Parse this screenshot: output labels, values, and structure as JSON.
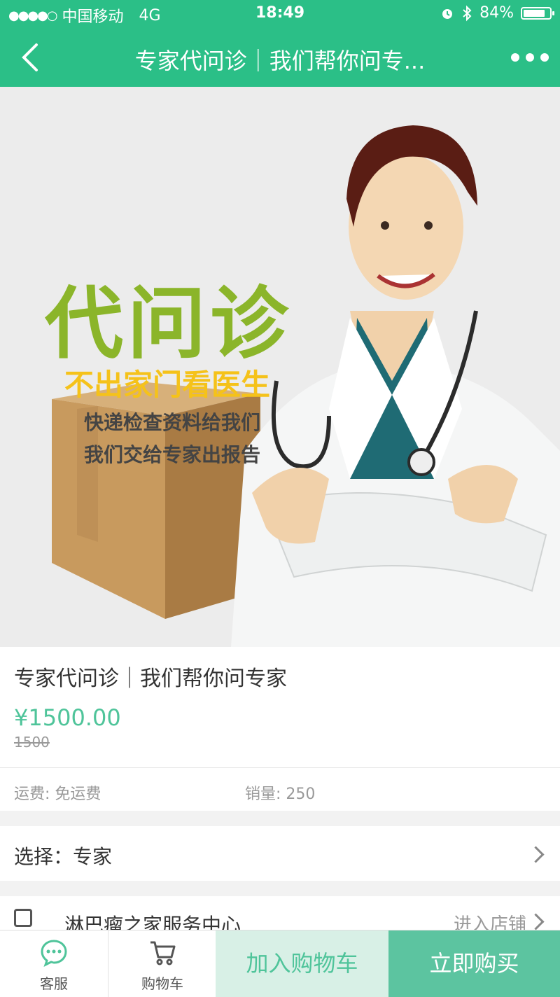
{
  "status_bar": {
    "signal": "●●●●○",
    "carrier": "中国移动",
    "network": "4G",
    "time": "18:49",
    "battery_percent": "84%",
    "battery_level": 0.84,
    "icons": [
      "alarm-icon",
      "bluetooth-icon",
      "battery-icon"
    ]
  },
  "navbar": {
    "title": "专家代问诊｜我们帮你问专...",
    "back_icon": "chevron-left-icon",
    "more_icon": "more-dots-icon"
  },
  "banner": {
    "headline": "代问诊",
    "subheadline": "不出家门看医生",
    "line1": "快递检查资料给我们",
    "line2": "我们交给专家出报告"
  },
  "product": {
    "title": "专家代问诊｜我们帮你问专家",
    "price": "¥1500.00",
    "original_price": "1500",
    "shipping": "运费: 免运费",
    "sales": "销量: 250"
  },
  "options": {
    "select_label": "选择：专家"
  },
  "store": {
    "name": "淋巴瘤之家服务中心",
    "enter_label": "进入店铺"
  },
  "bottom_bar": {
    "service_label": "客服",
    "cart_label": "购物车",
    "add_to_cart": "加入购物车",
    "buy_now": "立即购买"
  },
  "colors": {
    "brand_green": "#2bbf87",
    "price_green": "#4fc49a",
    "cart_button_bg": "#d8f0e6",
    "buy_button_bg": "#5cc4a0"
  }
}
